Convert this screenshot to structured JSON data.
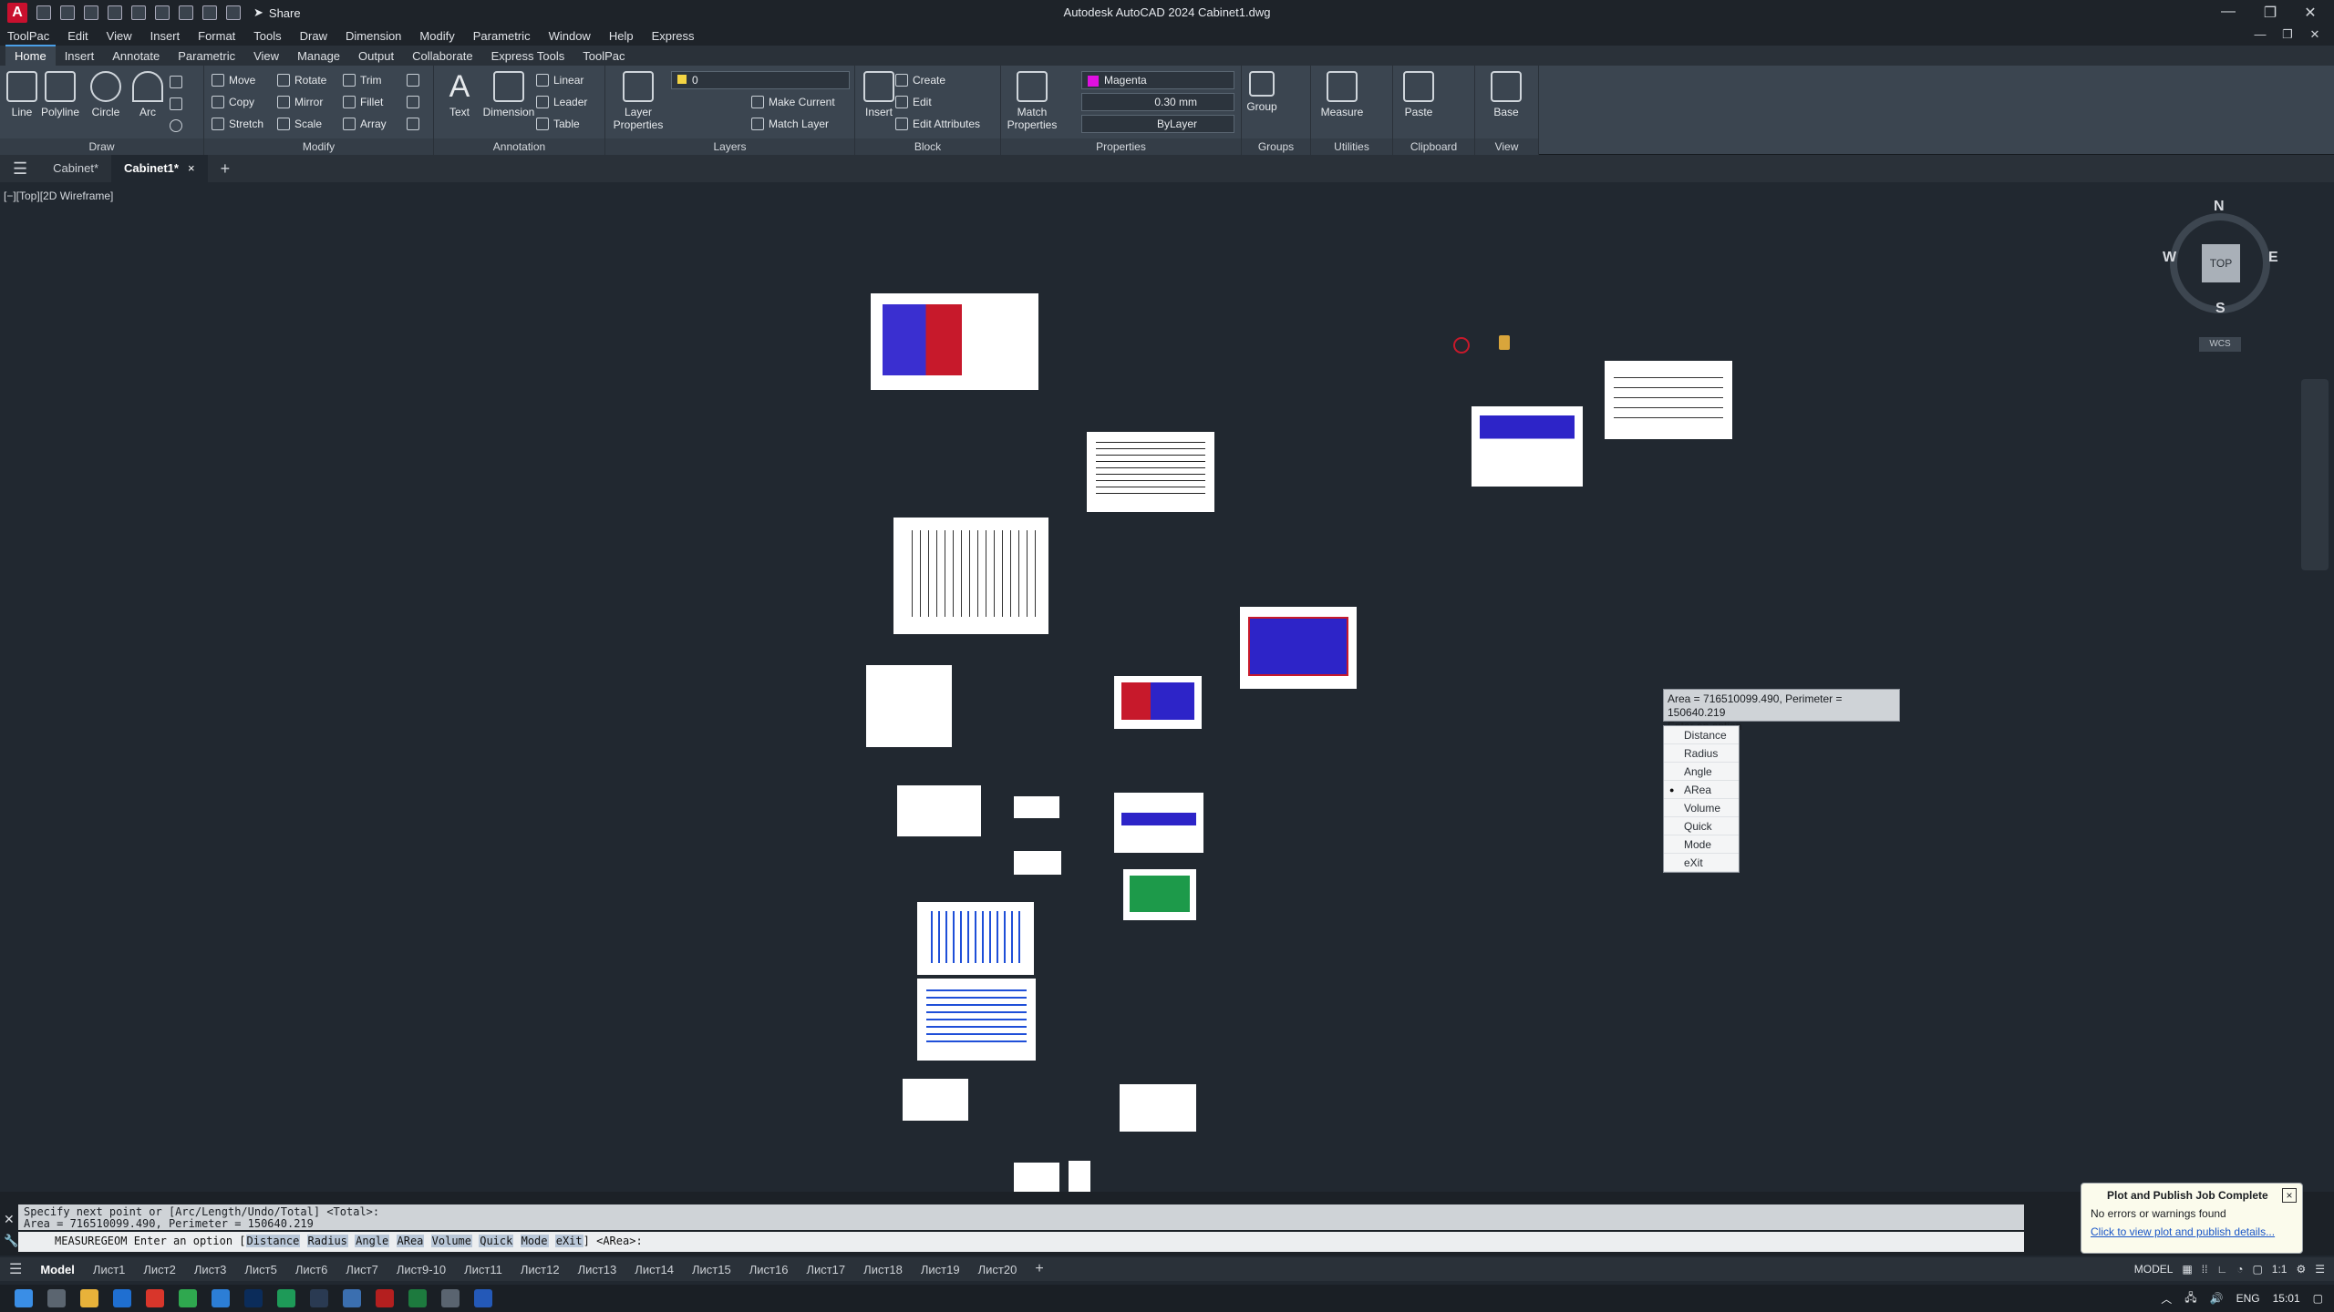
{
  "window": {
    "title": "Autodesk AutoCAD 2024   Cabinet1.dwg",
    "share_label": "Share"
  },
  "menu": [
    "ToolPac",
    "Edit",
    "View",
    "Insert",
    "Format",
    "Tools",
    "Draw",
    "Dimension",
    "Modify",
    "Parametric",
    "Window",
    "Help",
    "Express"
  ],
  "ribbon_tabs": [
    "Home",
    "Insert",
    "Annotate",
    "Parametric",
    "View",
    "Manage",
    "Output",
    "Collaborate",
    "Express Tools",
    "ToolPac"
  ],
  "ribbon": {
    "draw": {
      "title": "Draw",
      "tools": [
        "Line",
        "Polyline",
        "Circle",
        "Arc"
      ]
    },
    "modify": {
      "title": "Modify",
      "tools": [
        "Move",
        "Rotate",
        "Trim",
        "Copy",
        "Mirror",
        "Fillet",
        "Stretch",
        "Scale",
        "Array"
      ]
    },
    "annotation": {
      "title": "Annotation",
      "tools": [
        "Text",
        "Dimension",
        "Linear",
        "Leader",
        "Table"
      ]
    },
    "layers": {
      "title": "Layers",
      "layer_props": "Layer Properties",
      "current_layer": "0",
      "make_current": "Make Current",
      "match_layer": "Match Layer"
    },
    "block": {
      "title": "Block",
      "insert": "Insert",
      "create": "Create",
      "edit": "Edit",
      "edit_attributes": "Edit Attributes"
    },
    "properties": {
      "title": "Properties",
      "match": "Match Properties",
      "color": "Magenta",
      "lineweight": "0.30 mm",
      "linetype": "ByLayer"
    },
    "groups": {
      "title": "Groups",
      "group": "Group"
    },
    "utilities": {
      "title": "Utilities",
      "measure": "Measure"
    },
    "clipboard": {
      "title": "Clipboard",
      "paste": "Paste"
    },
    "view": {
      "title": "View",
      "base": "Base"
    }
  },
  "file_tabs": [
    "Cabinet*",
    "Cabinet1*"
  ],
  "viewport": {
    "label": "[−][Top][2D Wireframe]",
    "viewcube": {
      "n": "N",
      "s": "S",
      "e": "E",
      "w": "W",
      "face": "TOP",
      "wcs": "WCS"
    }
  },
  "tooltip": {
    "line1": "Area = 716510099.490, Perimeter = 150640.219",
    "line2": "Enter an option"
  },
  "options": [
    "Distance",
    "Radius",
    "Angle",
    "ARea",
    "Volume",
    "Quick",
    "Mode",
    "eXit"
  ],
  "selected_option": "ARea",
  "command": {
    "history1": "Specify next point or [Arc/Length/Undo/Total] <Total>:",
    "history2": "Area = 716510099.490, Perimeter = 150640.219",
    "prompt_prefix": "MEASUREGEOM Enter an option [",
    "keywords": [
      "Distance",
      "Radius",
      "Angle",
      "ARea",
      "Volume",
      "Quick",
      "Mode",
      "eXit"
    ],
    "prompt_suffix": "] <ARea>:"
  },
  "layout_tabs": [
    "Model",
    "Лист1",
    "Лист2",
    "Лист3",
    "Лист5",
    "Лист6",
    "Лист7",
    "Лист9-10",
    "Лист11",
    "Лист12",
    "Лист13",
    "Лист14",
    "Лист15",
    "Лист16",
    "Лист17",
    "Лист18",
    "Лист19",
    "Лист20"
  ],
  "status": {
    "model_label": "MODEL",
    "scale": "1:1"
  },
  "notification": {
    "title": "Plot and Publish Job Complete",
    "message": "No errors or warnings found",
    "link": "Click to view plot and publish details..."
  },
  "tray": {
    "lang": "ENG",
    "time": "15:01"
  },
  "colors": {
    "background": "#212830",
    "accent": "#4a9fe8",
    "magenta": "#e010e0"
  }
}
